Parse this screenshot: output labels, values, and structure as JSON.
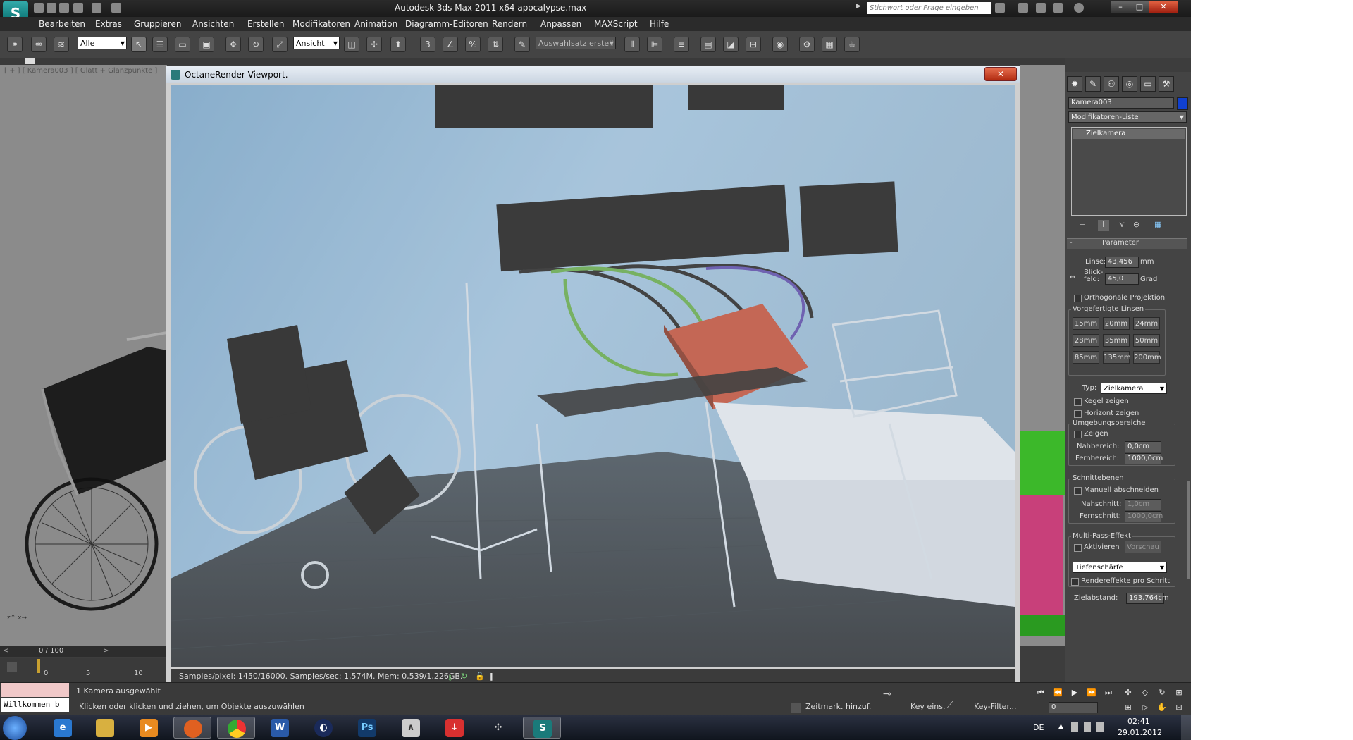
{
  "window": {
    "title": "Autodesk 3ds Max  2011 x64    apocalypse.max",
    "search_placeholder": "Stichwort oder Frage eingeben",
    "controls": {
      "minimize": "–",
      "maximize": "□",
      "close": "✕"
    }
  },
  "menu": [
    "Bearbeiten",
    "Extras",
    "Gruppieren",
    "Ansichten",
    "Erstellen",
    "Modifikatoren",
    "Animation",
    "Diagramm-Editoren",
    "Rendern",
    "Anpassen",
    "MAXScript",
    "Hilfe"
  ],
  "toolbar": {
    "selection_filter": "Alle",
    "reference_coord": "Ansicht",
    "named_selection": "Auswahlsatz erstell"
  },
  "viewport_left": {
    "label": "[ + ] [ Kamera003 ] [ Glatt + Glanzpunkte ]",
    "frame_counter": "0 / 100"
  },
  "octane": {
    "title": "OctaneRender Viewport.",
    "status": "Samples/pixel: 1450/16000. Samples/sec: 1,574M. Mem: 0,539/1,226GB."
  },
  "command_panel": {
    "object_name": "Kamera003",
    "modifier_list": "Modifikatoren-Liste",
    "stack_item": "Zielkamera",
    "rollout_title": "Parameter",
    "lens_label": "Linse:",
    "lens_value": "43,456",
    "lens_unit": "mm",
    "fov_label": "Blick-\nfeld:",
    "fov_value": "45,0",
    "fov_unit": "Grad",
    "ortho_label": "Orthogonale Projektion",
    "stock_lenses_title": "Vorgefertigte Linsen",
    "stock_lenses": [
      "15mm",
      "20mm",
      "24mm",
      "28mm",
      "35mm",
      "50mm",
      "85mm",
      "135mm",
      "200mm"
    ],
    "type_label": "Typ:",
    "type_value": "Zielkamera",
    "show_cone": "Kegel zeigen",
    "show_horizon": "Horizont zeigen",
    "env_ranges_title": "Umgebungsbereiche",
    "env_show": "Zeigen",
    "near_range_label": "Nahbereich:",
    "near_range_value": "0,0cm",
    "far_range_label": "Fernbereich:",
    "far_range_value": "1000,0cm",
    "clipping_title": "Schnittebenen",
    "clip_manually": "Manuell abschneiden",
    "near_clip_label": "Nahschnitt:",
    "near_clip_value": "1,0cm",
    "far_clip_label": "Fernschnitt:",
    "far_clip_value": "1000,0cm",
    "multipass_title": "Multi-Pass-Effekt",
    "multipass_enable": "Aktivieren",
    "multipass_preview": "Vorschau",
    "multipass_effect": "Tiefenschärfe",
    "render_effects": "Rendereffekte pro Schritt",
    "target_dist_label": "Zielabstand:",
    "target_dist_value": "193,764cm"
  },
  "trackbar": {
    "ticks": [
      "0",
      "5",
      "10"
    ]
  },
  "status": {
    "maxscript": "Willkommen b",
    "selection": "1 Kamera ausgewählt",
    "prompt": "Klicken oder klicken und ziehen, um Objekte auszuwählen",
    "add_time_tag": "Zeitmark. hinzuf.",
    "set_key": "Key eins.",
    "key_filters": "Key-Filter...",
    "frame_field": "0"
  },
  "taskbar": {
    "language": "DE",
    "time": "02:41",
    "date": "29.01.2012",
    "apps": [
      "start-orb",
      "internet-explorer",
      "explorer",
      "media-player",
      "firefox",
      "chrome",
      "word",
      "cinema4d",
      "photoshop",
      "autodesk-app",
      "download-app",
      "tool-app",
      "3dsmax"
    ]
  }
}
